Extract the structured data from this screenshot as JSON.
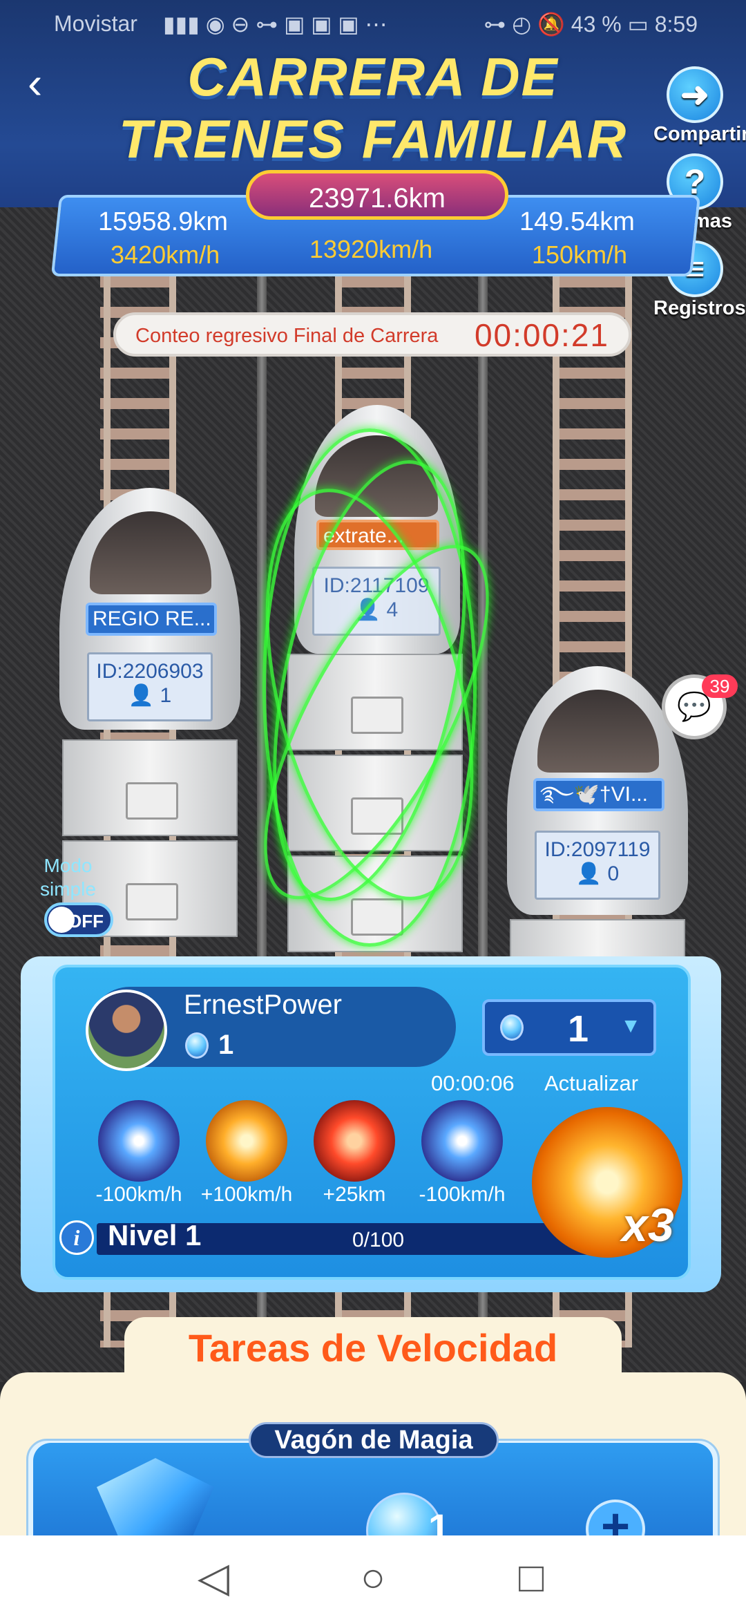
{
  "status_bar": {
    "carrier": "Movistar",
    "battery": "43 %",
    "time": "8:59"
  },
  "header": {
    "title_line1": "CARRERA DE",
    "title_line2": "TRENES FAMILIAR",
    "buttons": {
      "share": "Compartir",
      "rules": "Normas",
      "records": "Registros"
    }
  },
  "race": {
    "total_distance": "23971.6km",
    "left": {
      "distance": "15958.9km",
      "speed": "3420km/h"
    },
    "center": {
      "speed": "13920km/h"
    },
    "right": {
      "distance": "149.54km",
      "speed": "150km/h"
    },
    "countdown_label": "Conteo regresivo Final de Carrera",
    "countdown_time": "00:00:21"
  },
  "trains": [
    {
      "name": "REGIO RE...",
      "id": "ID:2206903",
      "members": "1"
    },
    {
      "name": "extrate...",
      "id": "ID:2117109",
      "members": "4"
    },
    {
      "name": "࿐🕊️†VI...",
      "id": "ID:2097119",
      "members": "0"
    }
  ],
  "chat": {
    "badge": "39"
  },
  "simple_mode": {
    "label_line1": "Modo",
    "label_line2": "simple",
    "toggle": "OFF"
  },
  "user": {
    "name": "ErnestPower",
    "gems": "1",
    "selector_value": "1",
    "timer": "00:00:06",
    "update_label": "Actualizar",
    "skills": [
      {
        "icon": "blue-star-burst-icon",
        "label": "-100km/h"
      },
      {
        "icon": "orange-fire-burst-icon",
        "label": "+100km/h"
      },
      {
        "icon": "red-spring-icon",
        "label": "+25km"
      },
      {
        "icon": "blue-star-burst-icon",
        "label": "-100km/h"
      }
    ],
    "multiplier": "x3",
    "level": "Nivel 1",
    "progress": "0/100",
    "progress_fraction": 0
  },
  "tasks": {
    "title": "Tareas de Velocidad",
    "card_label": "Vagón de Magia",
    "quantity": "1"
  },
  "colors": {
    "accent_blue": "#1e8fe2",
    "title_yellow": "#ffe86b",
    "countdown_red": "#d23b2a",
    "tasks_orange": "#ff5a1a",
    "speed_yellow": "#ffcc33"
  }
}
